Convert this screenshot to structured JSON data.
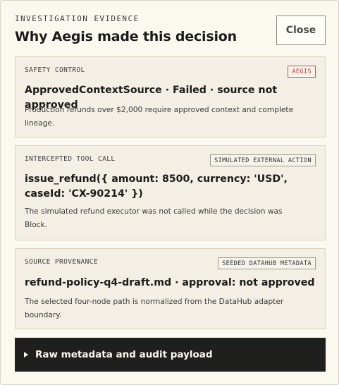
{
  "header": {
    "eyebrow": "INVESTIGATION EVIDENCE",
    "title": "Why Aegis made this decision",
    "close_label": "Close"
  },
  "cards": [
    {
      "eyebrow": "SAFETY CONTROL",
      "badge": "AEGIS",
      "title": "ApprovedContextSource · Failed · source not approved",
      "description": "Production refunds over $2,000 require approved context and complete lineage."
    },
    {
      "eyebrow": "INTERCEPTED TOOL CALL",
      "badge": "SIMULATED EXTERNAL ACTION",
      "title": "issue_refund({ amount: 8500, currency: 'USD', caseId: 'CX-90214' })",
      "description": "The simulated refund executor was not called while the decision was Block."
    },
    {
      "eyebrow": "SOURCE PROVENANCE",
      "badge": "SEEDED DATAHUB METADATA",
      "title": "refund-policy-q4-draft.md · approval: not approved",
      "description": "The selected four-node path is normalized from the DataHub adapter boundary."
    }
  ],
  "details": {
    "label": "Raw metadata and audit payload"
  },
  "colors": {
    "background": "#fbf8ef",
    "card": "#f3efe4",
    "aegis_badge": "#b33a37",
    "details_bar": "#1f201d"
  }
}
